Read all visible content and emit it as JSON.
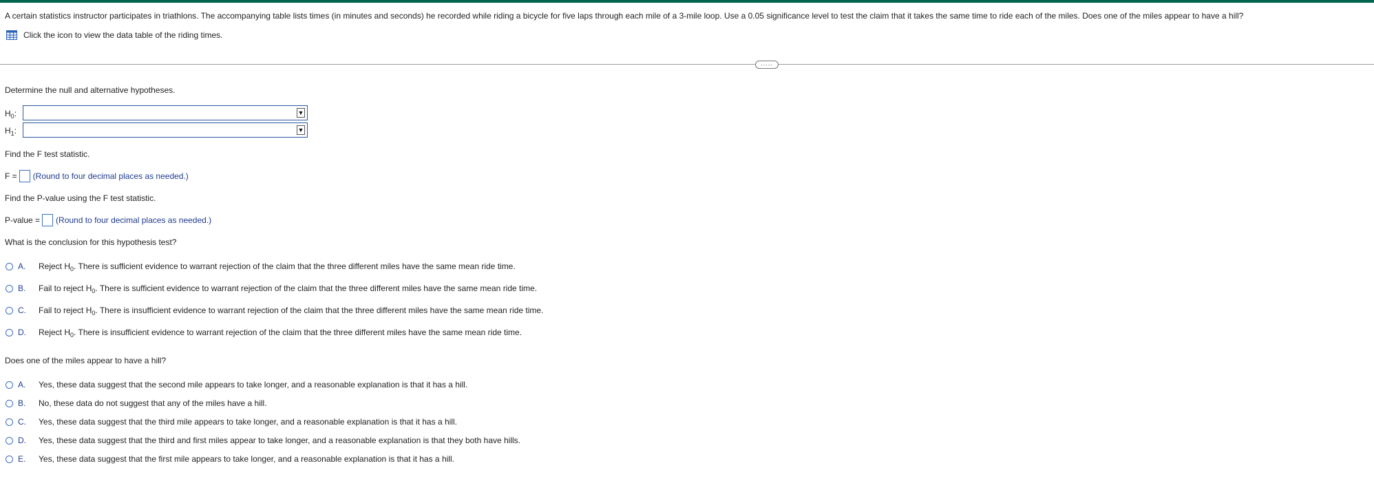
{
  "question": {
    "text": "A certain statistics instructor participates in triathlons. The accompanying table lists times (in minutes and seconds) he recorded while riding a bicycle for five laps through each mile of a 3-mile loop. Use a 0.05 significance level to test the claim that it takes the same time to ride each of the miles. Does one of the miles appear to have a hill?",
    "data_link": "Click the icon to view the data table of the riding times.",
    "data_icon": "table-icon"
  },
  "colors": {
    "accent_bar": "#00634d",
    "option_letter": "#1f3b8f",
    "input_border": "#3a6fc8"
  },
  "divider": {
    "expand_label": "....."
  },
  "hypotheses": {
    "prompt": "Determine the null and alternative hypotheses.",
    "h0_label": "H",
    "h0_sub": "0",
    "h1_label": "H",
    "h1_sub": "1",
    "colon": ":",
    "arrow": "▼"
  },
  "fstat": {
    "prompt": "Find the F test statistic.",
    "label": "F =",
    "hint": "(Round to four decimal places as needed.)"
  },
  "pvalue": {
    "prompt": "Find the P-value using the F test statistic.",
    "label": "P-value =",
    "hint": "(Round to four decimal places as needed.)"
  },
  "conclusion": {
    "prompt": "What is the conclusion for this hypothesis test?",
    "options": [
      {
        "letter": "A.",
        "pre": "Reject H",
        "sub": "0",
        "post": ". There is sufficient evidence to warrant rejection of the claim that the three different miles have the same mean ride time."
      },
      {
        "letter": "B.",
        "pre": "Fail to reject H",
        "sub": "0",
        "post": ". There is sufficient evidence to warrant rejection of the claim that the three different miles have the same mean ride time."
      },
      {
        "letter": "C.",
        "pre": "Fail to reject H",
        "sub": "0",
        "post": ". There is insufficient evidence to warrant rejection of the claim that the three different miles have the same mean ride time."
      },
      {
        "letter": "D.",
        "pre": "Reject H",
        "sub": "0",
        "post": ". There is insufficient evidence to warrant rejection of the claim that the three different miles have the same mean ride time."
      }
    ]
  },
  "hill": {
    "prompt": "Does one of the miles appear to have a hill?",
    "options": [
      {
        "letter": "A.",
        "text": "Yes, these data suggest that the second mile appears to take longer, and a reasonable explanation is that it has a hill."
      },
      {
        "letter": "B.",
        "text": "No, these data do not suggest that any of the miles have a hill."
      },
      {
        "letter": "C.",
        "text": "Yes, these data suggest that the third mile appears to take longer, and a reasonable explanation is that it has a hill."
      },
      {
        "letter": "D.",
        "text": "Yes, these data suggest that the third and first miles appear to take longer, and a reasonable explanation is that they both have hills."
      },
      {
        "letter": "E.",
        "text": "Yes, these data suggest that the first mile appears to take longer, and a reasonable explanation is that it has a hill."
      }
    ]
  }
}
